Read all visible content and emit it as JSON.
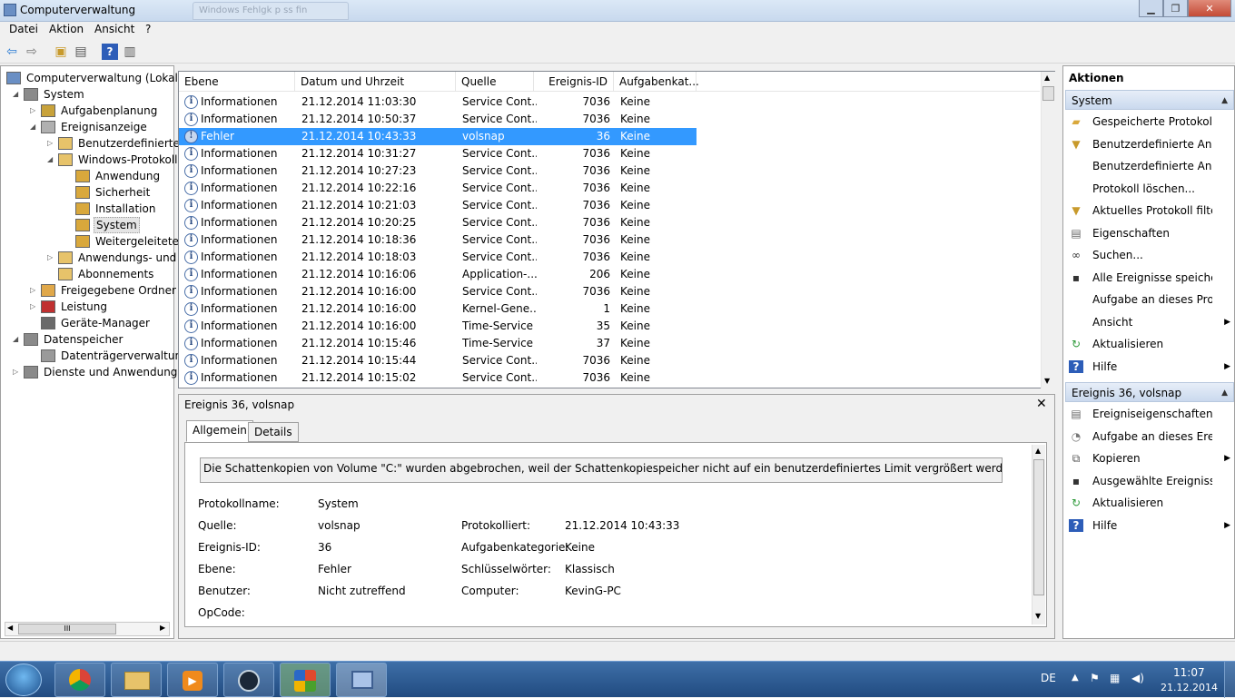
{
  "window": {
    "title": "Computerverwaltung",
    "ghost_tab": "Windows Fehlgk p ss fin"
  },
  "menu": [
    "Datei",
    "Aktion",
    "Ansicht",
    "?"
  ],
  "tree": [
    {
      "label": "Computerverwaltung (Lokal)",
      "level": 0,
      "expander": ""
    },
    {
      "label": "System",
      "level": 1,
      "expander": "◢"
    },
    {
      "label": "Aufgabenplanung",
      "level": 2,
      "expander": "▷"
    },
    {
      "label": "Ereignisanzeige",
      "level": 2,
      "expander": "◢"
    },
    {
      "label": "Benutzerdefinierte A",
      "level": 3,
      "expander": "▷"
    },
    {
      "label": "Windows-Protokolle",
      "level": 3,
      "expander": "◢"
    },
    {
      "label": "Anwendung",
      "level": 4,
      "expander": ""
    },
    {
      "label": "Sicherheit",
      "level": 4,
      "expander": ""
    },
    {
      "label": "Installation",
      "level": 4,
      "expander": ""
    },
    {
      "label": "System",
      "level": 4,
      "expander": ""
    },
    {
      "label": "Weitergeleitete E",
      "level": 4,
      "expander": ""
    },
    {
      "label": "Anwendungs- und D",
      "level": 3,
      "expander": "▷"
    },
    {
      "label": "Abonnements",
      "level": 3,
      "expander": ""
    },
    {
      "label": "Freigegebene Ordner",
      "level": 2,
      "expander": "▷"
    },
    {
      "label": "Leistung",
      "level": 2,
      "expander": "▷"
    },
    {
      "label": "Geräte-Manager",
      "level": 2,
      "expander": ""
    },
    {
      "label": "Datenspeicher",
      "level": 1,
      "expander": "◢"
    },
    {
      "label": "Datenträgerverwaltung",
      "level": 2,
      "expander": ""
    },
    {
      "label": "Dienste und Anwendungen",
      "level": 1,
      "expander": "▷"
    }
  ],
  "tree_scroll_mark": "III",
  "columns": [
    "Ebene",
    "Datum und Uhrzeit",
    "Quelle",
    "Ereignis-ID",
    "Aufgabenkat..."
  ],
  "rows": [
    [
      "Informationen",
      "21.12.2014 11:03:30",
      "Service Cont...",
      "7036",
      "Keine"
    ],
    [
      "Informationen",
      "21.12.2014 10:50:37",
      "Service Cont...",
      "7036",
      "Keine"
    ],
    [
      "Fehler",
      "21.12.2014 10:43:33",
      "volsnap",
      "36",
      "Keine"
    ],
    [
      "Informationen",
      "21.12.2014 10:31:27",
      "Service Cont...",
      "7036",
      "Keine"
    ],
    [
      "Informationen",
      "21.12.2014 10:27:23",
      "Service Cont...",
      "7036",
      "Keine"
    ],
    [
      "Informationen",
      "21.12.2014 10:22:16",
      "Service Cont...",
      "7036",
      "Keine"
    ],
    [
      "Informationen",
      "21.12.2014 10:21:03",
      "Service Cont...",
      "7036",
      "Keine"
    ],
    [
      "Informationen",
      "21.12.2014 10:20:25",
      "Service Cont...",
      "7036",
      "Keine"
    ],
    [
      "Informationen",
      "21.12.2014 10:18:36",
      "Service Cont...",
      "7036",
      "Keine"
    ],
    [
      "Informationen",
      "21.12.2014 10:18:03",
      "Service Cont...",
      "7036",
      "Keine"
    ],
    [
      "Informationen",
      "21.12.2014 10:16:06",
      "Application-...",
      "206",
      "Keine"
    ],
    [
      "Informationen",
      "21.12.2014 10:16:00",
      "Service Cont...",
      "7036",
      "Keine"
    ],
    [
      "Informationen",
      "21.12.2014 10:16:00",
      "Kernel-Gene...",
      "1",
      "Keine"
    ],
    [
      "Informationen",
      "21.12.2014 10:16:00",
      "Time-Service",
      "35",
      "Keine"
    ],
    [
      "Informationen",
      "21.12.2014 10:15:46",
      "Time-Service",
      "37",
      "Keine"
    ],
    [
      "Informationen",
      "21.12.2014 10:15:44",
      "Service Cont...",
      "7036",
      "Keine"
    ],
    [
      "Informationen",
      "21.12.2014 10:15:02",
      "Service Cont...",
      "7036",
      "Keine"
    ]
  ],
  "detail": {
    "title": "Ereignis 36, volsnap",
    "tabs": [
      "Allgemein",
      "Details"
    ],
    "message": "Die Schattenkopien von Volume \"C:\" wurden abgebrochen, weil der Schattenkopiespeicher nicht auf ein benutzerdefiniertes Limit vergrößert werden konnte.",
    "fields": {
      "protokollname_label": "Protokollname:",
      "protokollname": "System",
      "quelle_label": "Quelle:",
      "quelle": "volsnap",
      "protokolliert_label": "Protokolliert:",
      "protokolliert": "21.12.2014 10:43:33",
      "ereignisid_label": "Ereignis-ID:",
      "ereignisid": "36",
      "aufgabenkat_label": "Aufgabenkategorie:",
      "aufgabenkat": "Keine",
      "ebene_label": "Ebene:",
      "ebene": "Fehler",
      "schluessel_label": "Schlüsselwörter:",
      "schluessel": "Klassisch",
      "benutzer_label": "Benutzer:",
      "benutzer": "Nicht zutreffend",
      "computer_label": "Computer:",
      "computer": "KevinG-PC",
      "opcode_label": "OpCode:"
    }
  },
  "actions": {
    "title": "Aktionen",
    "group1": "System",
    "items1": [
      {
        "label": "Gespeicherte Protokoll...",
        "icon": "folder-open-icon",
        "arrow": false
      },
      {
        "label": "Benutzerdefinierte Ansi...",
        "icon": "filter-icon",
        "arrow": false
      },
      {
        "label": "Benutzerdefinierte Ansi...",
        "icon": "",
        "arrow": false
      },
      {
        "label": "Protokoll löschen...",
        "icon": "",
        "arrow": false
      },
      {
        "label": "Aktuelles Protokoll filte...",
        "icon": "filter-icon",
        "arrow": false
      },
      {
        "label": "Eigenschaften",
        "icon": "properties-icon",
        "arrow": false
      },
      {
        "label": "Suchen...",
        "icon": "binoculars-icon",
        "arrow": false
      },
      {
        "label": "Alle Ereignisse speicher...",
        "icon": "save-icon",
        "arrow": false
      },
      {
        "label": "Aufgabe an dieses Prot...",
        "icon": "",
        "arrow": false
      },
      {
        "label": "Ansicht",
        "icon": "",
        "arrow": true
      },
      {
        "label": "Aktualisieren",
        "icon": "refresh-icon",
        "arrow": false
      },
      {
        "label": "Hilfe",
        "icon": "help-icon",
        "arrow": true
      }
    ],
    "group2": "Ereignis 36, volsnap",
    "items2": [
      {
        "label": "Ereigniseigenschaften",
        "icon": "properties-icon",
        "arrow": false
      },
      {
        "label": "Aufgabe an dieses Erei...",
        "icon": "task-icon",
        "arrow": false
      },
      {
        "label": "Kopieren",
        "icon": "copy-icon",
        "arrow": true
      },
      {
        "label": "Ausgewählte Ereignisse...",
        "icon": "save-icon",
        "arrow": false
      },
      {
        "label": "Aktualisieren",
        "icon": "refresh-icon",
        "arrow": false
      },
      {
        "label": "Hilfe",
        "icon": "help-icon",
        "arrow": true
      }
    ]
  },
  "taskbar": {
    "lang": "DE",
    "time": "11:07",
    "date": "21.12.2014"
  },
  "colors": {
    "selection": "#3399ff",
    "taskbar": "#214b80"
  }
}
